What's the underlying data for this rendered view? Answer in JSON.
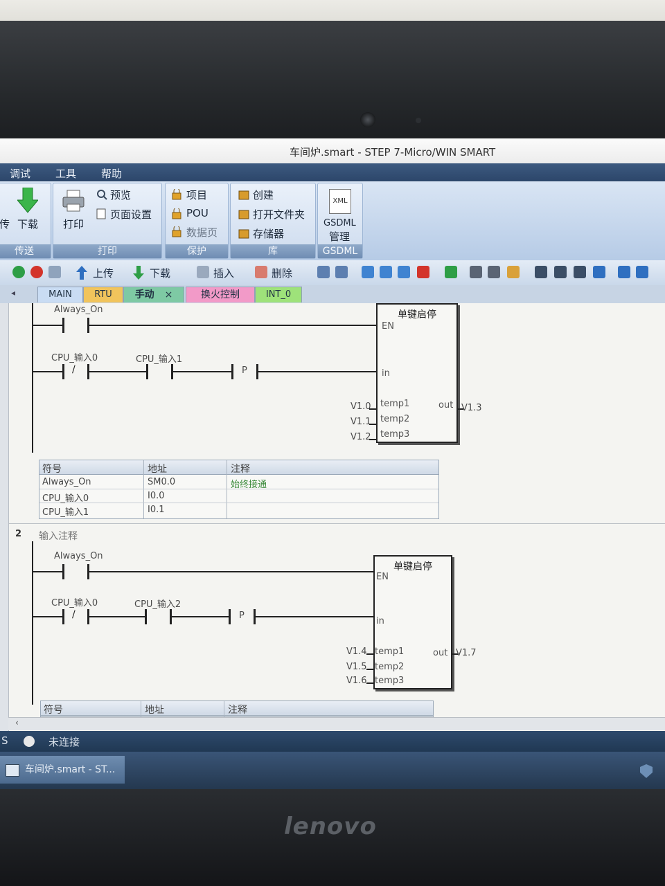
{
  "window": {
    "title": "车间炉.smart - STEP 7-Micro/WIN SMART"
  },
  "menu": {
    "items": [
      "调试",
      "工具",
      "帮助"
    ]
  },
  "ribbon": {
    "transfer": {
      "download": "下载",
      "upload_partial": "传",
      "label": "传送"
    },
    "print": {
      "print": "打印",
      "preview": "预览",
      "page_setup": "页面设置",
      "label": "打印"
    },
    "protect": {
      "project": "项目",
      "pou": "POU",
      "data_page": "数据页",
      "label": "保护"
    },
    "library": {
      "create": "创建",
      "open_folder": "打开文件夹",
      "memory": "存储器",
      "label": "库"
    },
    "gsdml": {
      "xml": "XML",
      "manage_line1": "GSDML",
      "manage_line2": "管理",
      "label": "GSDML"
    }
  },
  "toolbar": {
    "upload": "上传",
    "download": "下载",
    "insert": "插入",
    "delete": "删除"
  },
  "tabs": [
    {
      "label": "MAIN",
      "color": "#c9dcf3"
    },
    {
      "label": "RTU",
      "color": "#f1c45c"
    },
    {
      "label": "手动",
      "color": "#7ec9a4",
      "close": "×"
    },
    {
      "label": "换火控制",
      "color": "#f29ac8"
    },
    {
      "label": "INT_0",
      "color": "#9ee27a"
    }
  ],
  "network1": {
    "contacts": {
      "always_on": "Always_On",
      "input0": "CPU_输入0",
      "input1": "CPU_输入1",
      "neg": "/",
      "pulse": "P"
    },
    "block": {
      "title": "单键启停",
      "en": "EN",
      "in": "in",
      "temp1": "temp1",
      "temp2": "temp2",
      "temp3": "temp3",
      "out": "out",
      "temp1_val": "V1.0",
      "temp2_val": "V1.1",
      "temp3_val": "V1.2",
      "out_val": "V1.3"
    },
    "symbols": {
      "headers": {
        "symbol": "符号",
        "address": "地址",
        "comment": "注释"
      },
      "rows": [
        {
          "symbol": "Always_On",
          "address": "SM0.0",
          "comment": "始终接通"
        },
        {
          "symbol": "CPU_输入0",
          "address": "I0.0",
          "comment": ""
        },
        {
          "symbol": "CPU_输入1",
          "address": "I0.1",
          "comment": ""
        }
      ]
    }
  },
  "network2": {
    "number": "2",
    "comment": "输入注释",
    "contacts": {
      "always_on": "Always_On",
      "input0": "CPU_输入0",
      "input2": "CPU_输入2",
      "neg": "/",
      "pulse": "P"
    },
    "block": {
      "title": "单键启停",
      "en": "EN",
      "in": "in",
      "temp1": "temp1",
      "temp2": "temp2",
      "temp3": "temp3",
      "out": "out",
      "temp1_val": "V1.4",
      "temp2_val": "V1.5",
      "temp3_val": "V1.6",
      "out_val": "V1.7"
    },
    "symbols": {
      "headers": {
        "symbol": "符号",
        "address": "地址",
        "comment": "注释"
      }
    }
  },
  "status": {
    "connection": "未连接",
    "left_char": "S"
  },
  "taskbar": {
    "item": "车间炉.smart - ST..."
  },
  "laptop": {
    "brand": "lenovo"
  }
}
